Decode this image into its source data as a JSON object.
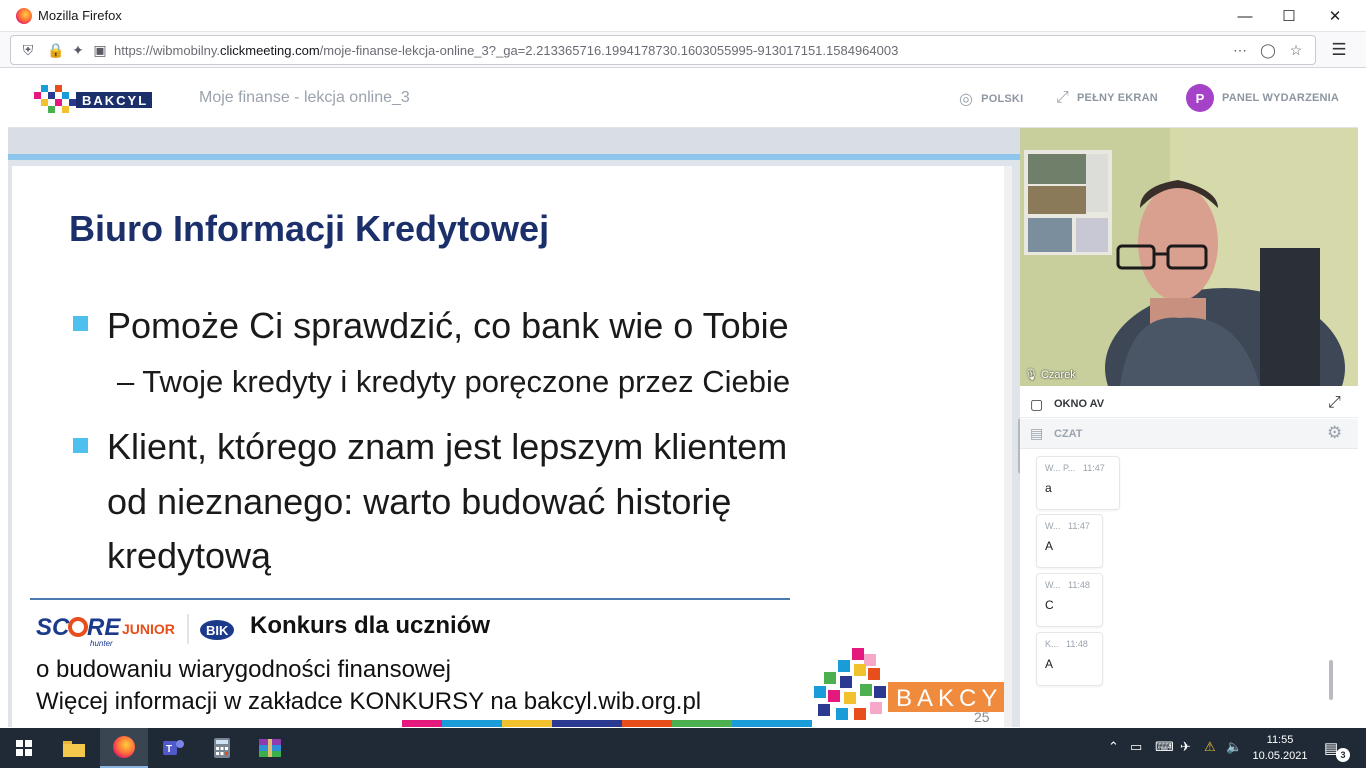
{
  "browser": {
    "window_title": "Mozilla Firefox",
    "url_prefix": "https://wibmobilny.",
    "url_domain": "clickmeeting.com",
    "url_path": "/moje-finanse-lekcja-online_3?_ga=2.213365716.1994178730.1603055995-913017151.1584964003"
  },
  "header": {
    "brand": "BAKCYL",
    "event_title": "Moje finanse - lekcja online_3",
    "language_label": "POLSKI",
    "fullscreen_label": "PEŁNY EKRAN",
    "avatar_initial": "P",
    "panel_label": "PANEL WYDARZENIA"
  },
  "slide": {
    "title": "Biuro Informacji Kredytowej",
    "bullet1": "Pomoże Ci sprawdzić, co bank wie o Tobie",
    "sub_bullet": "– Twoje kredyty i kredyty poręczone przez Ciebie",
    "bullet2_line1": "Klient, którego znam jest lepszym klientem",
    "bullet2_line2": "od nieznanego: warto budować historię",
    "bullet2_line3": "kredytową",
    "score_logo": "SC",
    "score_logo_2": "RE",
    "junior_logo": "JUNIOR",
    "hunter_logo": "hunter",
    "bik_logo": "BIK",
    "konkurs_title": "Konkurs dla uczniów",
    "konkurs_line1": "o budowaniu wiarygodności finansowej",
    "konkurs_line2": "Więcej informacji w zakładce KONKURSY na bakcyl.wib.org.pl",
    "logo_text": "BAKCYL",
    "page_number": "25"
  },
  "video": {
    "participant_name": "Czarek"
  },
  "av_window": {
    "label": "OKNO AV"
  },
  "chat": {
    "label": "CZAT",
    "messages": [
      {
        "author": "W... P...",
        "time": "11:47",
        "text": "a"
      },
      {
        "author": "W...",
        "time": "11:47",
        "text": "A"
      },
      {
        "author": "W...",
        "time": "11:48",
        "text": "C"
      },
      {
        "author": "K...",
        "time": "11:48",
        "text": "A"
      }
    ]
  },
  "taskbar": {
    "time": "11:55",
    "date": "10.05.2021",
    "notification_count": "3"
  },
  "colors": {
    "slide_title": "#1b2f6b",
    "bullet": "#4ec0ee",
    "avatar": "#a542c7",
    "taskbar": "#1f2a36"
  }
}
